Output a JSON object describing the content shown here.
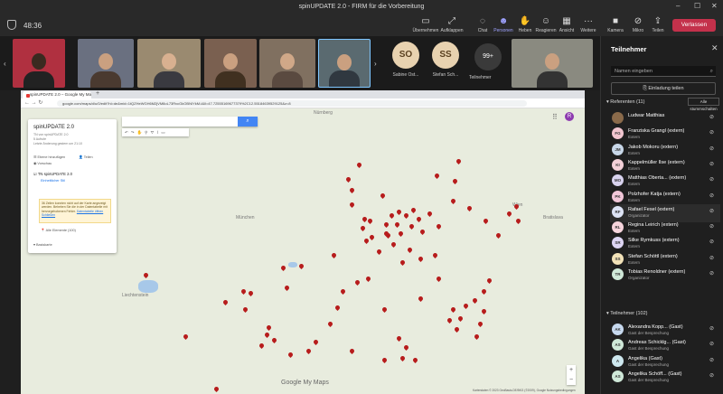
{
  "window": {
    "title": "spinUPDATE 2.0 - FIRM für die Vorbereitung",
    "timer": "48:36"
  },
  "toolbar": {
    "items": [
      {
        "label": "Übernehmen",
        "icon": "present-icon"
      },
      {
        "label": "Aufklappen",
        "icon": "expand-icon"
      },
      {
        "label": "Chat",
        "icon": "chat-icon"
      },
      {
        "label": "Personen",
        "icon": "people-icon"
      },
      {
        "label": "Heben",
        "icon": "hand-icon"
      },
      {
        "label": "Reagieren",
        "icon": "emoji-icon"
      },
      {
        "label": "Ansicht",
        "icon": "view-icon"
      },
      {
        "label": "Weitere",
        "icon": "more-icon"
      },
      {
        "label": "Kamera",
        "icon": "camera-icon"
      },
      {
        "label": "Mikro",
        "icon": "mic-icon"
      },
      {
        "label": "Teilen",
        "icon": "share-icon"
      }
    ],
    "leave": "Verlassen"
  },
  "strip": {
    "avatars": [
      {
        "initials": "SO",
        "name": "Sabine Ost..."
      },
      {
        "initials": "SS",
        "name": "Stefan Sch..."
      }
    ],
    "more_count": "99+",
    "more_label": "Teilnehmer"
  },
  "browser": {
    "tab": "spinUPDATE 2.0 – Google My Ma",
    "url": "google.com/maps/d/u/0/edit?hl=de&mid=1tQZHeWGH6M2jVM8oL73RvcGkOBNIYkM-t&ll=47.72555169677379%2C12.55184639529125&z=8",
    "profile_initial": "R"
  },
  "mymaps": {
    "title": "spinUPDATE 2.0",
    "sub1": "TN von spinUPDATE 2.0",
    "sub2": "5 Aufrufe",
    "sub3": "Letzte Änderung gestern um 21:10",
    "add_layer": "Ebene hinzufügen",
    "share": "Teilen",
    "preview": "Vorschau",
    "layer_name": "TN spinUPDATE 2.0",
    "layer_style": "Einheitlicher Stil",
    "warning": "36 Zeilen konnten nicht auf der Karte angezeigt werden. Beheben Sie die in der Datentabelle mit hervorgehobenen Fehler.",
    "warning_link": "Datentabelle öffnen Schließen",
    "all_items": "Alle Elemente (100)",
    "basemap": "Basiskarte",
    "search_btn": "⌕",
    "google": "Google My Maps",
    "copyright": "Kartendaten © 2023 GeoBasis-DE/BKG (©2009), Google  Nutzungsbedingungen",
    "cities": [
      "Nürnberg",
      "München",
      "Liechtenstein",
      "Bratislava",
      "Wien"
    ]
  },
  "sidebar": {
    "title": "Teilnehmer",
    "search_placeholder": "Namen eingeben",
    "invite": "Einladung teilen",
    "speakers_header": "Referenten (11)",
    "mute_all": "Alle stummschalten",
    "speakers": [
      {
        "initials": "",
        "name": "Ludwar Matthias",
        "role": "",
        "color": "#8a6a4a"
      },
      {
        "initials": "FG",
        "name": "Franziska Grangl (extern)",
        "role": "Extern",
        "color": "#f2c6d0"
      },
      {
        "initials": "JM",
        "name": "Jakob Mokoru (extern)",
        "role": "Extern",
        "color": "#c8d7e8"
      },
      {
        "initials": "KI",
        "name": "Kappelmüller Ilse (extern)",
        "role": "Extern",
        "color": "#f3d0d8"
      },
      {
        "initials": "MO",
        "name": "Matthias Oberta... (extern)",
        "role": "Extern",
        "color": "#d8d2ee"
      },
      {
        "initials": "PK",
        "name": "Polzhofer Katja (extern)",
        "role": "Extern",
        "color": "#f1c6d8"
      },
      {
        "initials": "RF",
        "name": "Rafael Fesel (extern)",
        "role": "Organizator",
        "color": "#dde3f5"
      },
      {
        "initials": "RL",
        "name": "Regina Leirich (extern)",
        "role": "Extern",
        "color": "#f6d4dc"
      },
      {
        "initials": "SR",
        "name": "Silke Rymkuss (extern)",
        "role": "Extern",
        "color": "#ddd5f3"
      },
      {
        "initials": "SS",
        "name": "Stefan Schöttl (extern)",
        "role": "Extern",
        "color": "#f2e2b8"
      },
      {
        "initials": "TR",
        "name": "Tobias Renoldner (extern)",
        "role": "Organizator",
        "color": "#cfe8d8"
      }
    ],
    "guests_header": "Teilnehmer (102)",
    "guests": [
      {
        "initials": "AK",
        "name": "Alexandra Kopp... (Gast)",
        "role": "Gast der Besprechung",
        "color": "#c6d8ee"
      },
      {
        "initials": "AS",
        "name": "Andreas Schicklg... (Gast)",
        "role": "Gast der Besprechung",
        "color": "#cfe8d8"
      },
      {
        "initials": "A",
        "name": "Angelika (Gast)",
        "role": "Gast der Besprechung",
        "color": "#cde7ee"
      },
      {
        "initials": "AS",
        "name": "Angelika Schöff... (Gast)",
        "role": "Gast der Besprechung",
        "color": "#cfe8d8"
      }
    ]
  }
}
